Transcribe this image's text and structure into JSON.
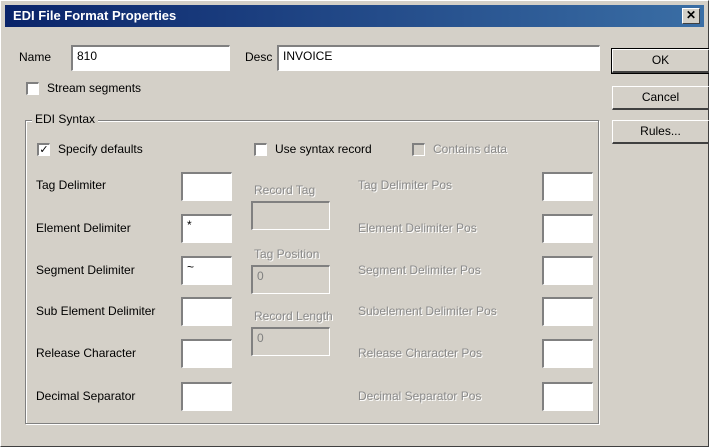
{
  "window": {
    "title": "EDI File Format Properties",
    "close_glyph": "✕"
  },
  "name": {
    "label": "Name",
    "value": "810"
  },
  "desc": {
    "label": "Desc",
    "value": "INVOICE"
  },
  "stream_segments": {
    "label": "Stream segments",
    "checked": false
  },
  "buttons": {
    "ok": "OK",
    "cancel": "Cancel",
    "rules": "Rules..."
  },
  "edi_syntax": {
    "group_label": "EDI Syntax",
    "specify_defaults": {
      "label": "Specify defaults",
      "checked": true,
      "mark": "✓"
    },
    "use_syntax_record": {
      "label": "Use syntax record",
      "checked": false
    },
    "contains_data": {
      "label": "Contains data",
      "checked": false
    },
    "left_fields": [
      {
        "label": "Tag Delimiter",
        "value": ""
      },
      {
        "label": "Element Delimiter",
        "value": "*"
      },
      {
        "label": "Segment Delimiter",
        "value": "~"
      },
      {
        "label": "Sub Element Delimiter",
        "value": ""
      },
      {
        "label": "Release Character",
        "value": ""
      },
      {
        "label": "Decimal Separator",
        "value": ""
      }
    ],
    "record_tag": {
      "label": "Record Tag",
      "value": ""
    },
    "tag_position": {
      "label": "Tag Position",
      "value": "0"
    },
    "record_length": {
      "label": "Record Length",
      "value": "0"
    },
    "right_fields": [
      {
        "label": "Tag Delimiter Pos",
        "value": ""
      },
      {
        "label": "Element Delimiter Pos",
        "value": ""
      },
      {
        "label": "Segment Delimiter Pos",
        "value": ""
      },
      {
        "label": "Subelement Delimiter Pos",
        "value": ""
      },
      {
        "label": "Release Character Pos",
        "value": ""
      },
      {
        "label": "Decimal Separator Pos",
        "value": ""
      }
    ]
  }
}
